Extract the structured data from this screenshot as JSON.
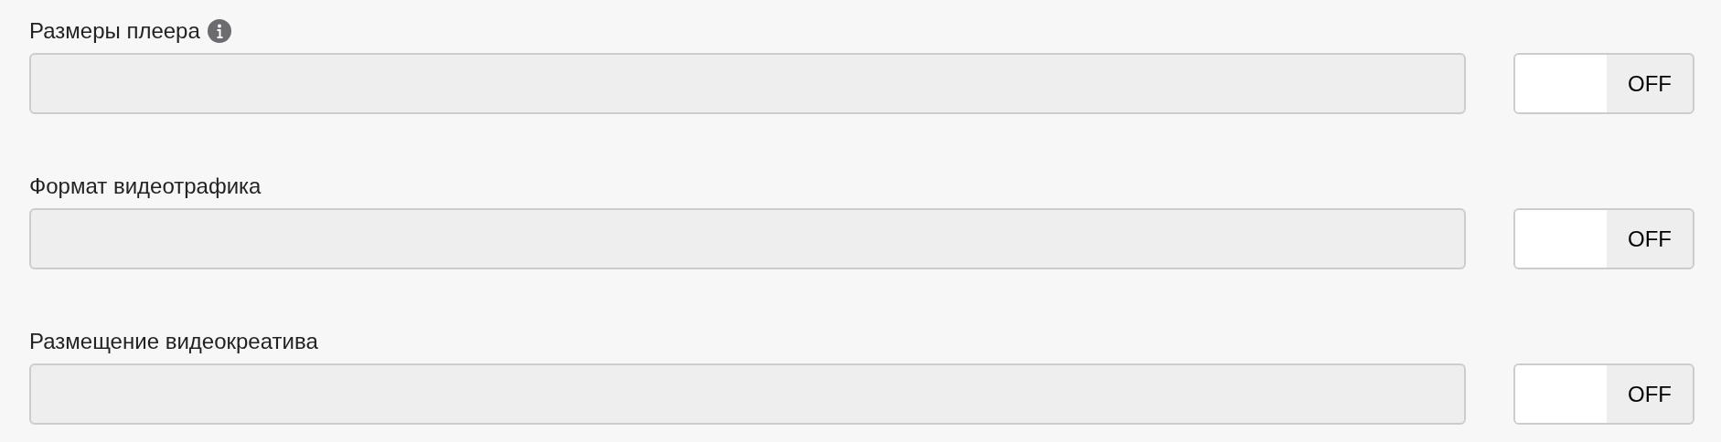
{
  "settings": [
    {
      "label": "Размеры плеера",
      "info": true,
      "field": {
        "disabled": true
      },
      "toggle": {
        "on": false,
        "text": "OFF"
      }
    },
    {
      "label": "Формат видеотрафика",
      "info": false,
      "field": {
        "disabled": true
      },
      "toggle": {
        "on": false,
        "text": "OFF"
      }
    },
    {
      "label": "Размещение видеокреатива",
      "info": false,
      "field": {
        "disabled": true
      },
      "toggle": {
        "on": false,
        "text": "OFF"
      }
    }
  ]
}
